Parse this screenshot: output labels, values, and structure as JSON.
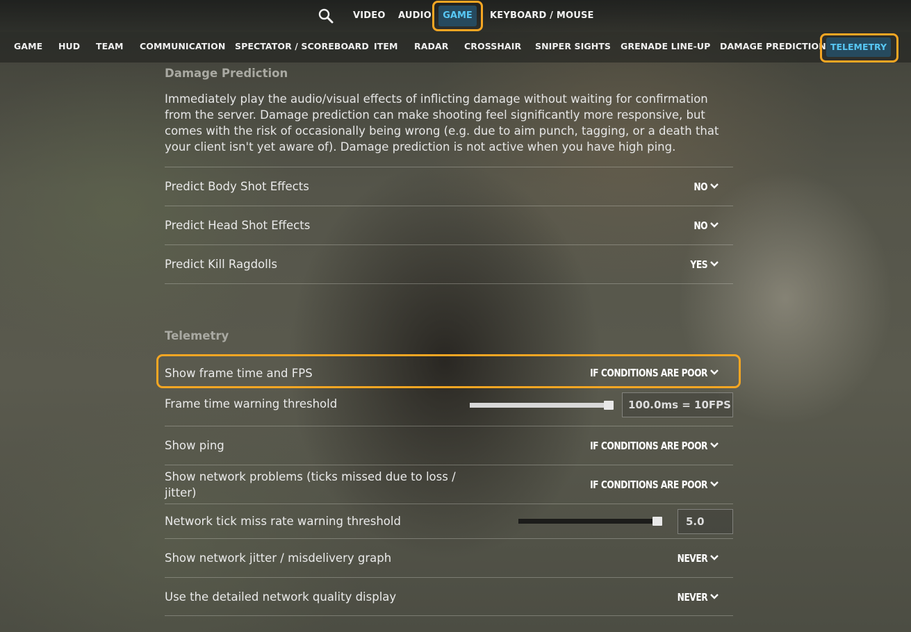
{
  "topnav": {
    "items": [
      "VIDEO",
      "AUDIO",
      "GAME",
      "KEYBOARD / MOUSE"
    ],
    "active": "GAME"
  },
  "subnav": {
    "items": [
      "GAME",
      "HUD",
      "TEAM",
      "COMMUNICATION",
      "SPECTATOR / SCOREBOARD",
      "ITEM",
      "RADAR",
      "CROSSHAIR",
      "SNIPER SIGHTS",
      "GRENADE LINE-UP",
      "DAMAGE PREDICTION",
      "TELEMETRY"
    ],
    "active": "TELEMETRY"
  },
  "damage_prediction": {
    "title": "Damage Prediction",
    "description": "Immediately play the audio/visual effects of inflicting damage without waiting for confirmation from the server. Damage prediction can make shooting feel significantly more responsive, but comes with the risk of occasionally being wrong (e.g. due to aim punch, tagging, or a death that your client isn't yet aware of). Damage prediction is not active when you have high ping.",
    "rows": [
      {
        "label": "Predict Body Shot Effects",
        "value": "NO"
      },
      {
        "label": "Predict Head Shot Effects",
        "value": "NO"
      },
      {
        "label": "Predict Kill Ragdolls",
        "value": "YES"
      }
    ]
  },
  "telemetry": {
    "title": "Telemetry",
    "show_frame_time": {
      "label": "Show frame time and FPS",
      "value": "IF CONDITIONS ARE POOR"
    },
    "frame_time_threshold": {
      "label": "Frame time warning threshold",
      "value": "100.0ms = 10FPS",
      "slider_level": 1.0
    },
    "show_ping": {
      "label": "Show ping",
      "value": "IF CONDITIONS ARE POOR"
    },
    "network_problems": {
      "label": "Show network problems (ticks missed due to loss / jitter)",
      "value": "IF CONDITIONS ARE POOR"
    },
    "tick_miss_threshold": {
      "label": "Network tick miss rate warning threshold",
      "value": "5.0",
      "slider_level": 1.0
    },
    "jitter_graph": {
      "label": "Show network jitter / misdelivery graph",
      "value": "NEVER"
    },
    "quality_display": {
      "label": "Use the detailed network quality display",
      "value": "NEVER"
    }
  },
  "colors": {
    "accent_highlight": "#f5a623",
    "active_tab_text": "#58c8f5",
    "active_tab_bg": "#264a5e"
  }
}
